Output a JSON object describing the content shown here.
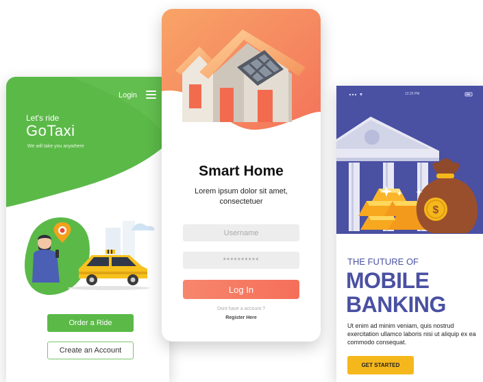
{
  "gotaxi": {
    "login_label": "Login",
    "menu_icon": "hamburger-menu-icon",
    "subtitle": "Let's ride",
    "title": "GoTaxi",
    "tagline": "We will take you anywhere",
    "order_button": "Order a Ride",
    "account_button": "Create an Account",
    "colors": {
      "accent": "#5bb948",
      "taxi": "#f7c21e"
    }
  },
  "smarthome": {
    "title": "Smart Home",
    "description": "Lorem ipsum dolor sit amet, consectetuer",
    "username_placeholder": "Username",
    "password_value": "**********",
    "login_button": "Log In",
    "no_account_text": "Dont have a account ?",
    "register_link": "Register Here",
    "colors": {
      "accent": "#f56f59"
    }
  },
  "banking": {
    "status_time": "12:25 PM",
    "pre_title": "THE FUTURE OF",
    "title_line1": "MOBILE",
    "title_line2": "BANKING",
    "body": "Ut enim ad minim veniam, quis nostrud exercitation ullamco laboris nisi ut aliquip ex ea commodo consequat.",
    "cta_button": "GET STARTED",
    "colors": {
      "accent": "#4a50a2",
      "cta": "#f5b81c"
    }
  }
}
